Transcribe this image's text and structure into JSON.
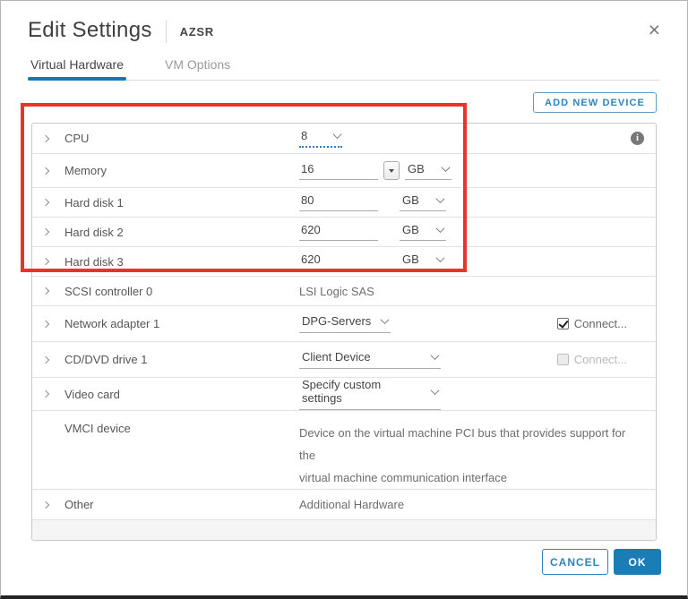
{
  "window": {
    "title": "Edit Settings",
    "vm_name": "AZSR",
    "close_icon": "×"
  },
  "tabs": [
    {
      "label": "Virtual Hardware",
      "active": true
    },
    {
      "label": "VM Options",
      "active": false
    }
  ],
  "toolbar": {
    "add_new_device": "ADD NEW DEVICE"
  },
  "hardware_rows": {
    "cpu": {
      "label": "CPU",
      "value": "8"
    },
    "memory": {
      "label": "Memory",
      "value": "16",
      "unit": "GB"
    },
    "hard_disk_1": {
      "label": "Hard disk 1",
      "value": "80",
      "unit": "GB"
    },
    "hard_disk_2": {
      "label": "Hard disk 2",
      "value": "620",
      "unit": "GB"
    },
    "hard_disk_3": {
      "label": "Hard disk 3",
      "value": "620",
      "unit": "GB"
    },
    "scsi_controller_0": {
      "label": "SCSI controller 0",
      "value": "LSI Logic SAS"
    },
    "network_adapter_1": {
      "label": "Network adapter 1",
      "value": "DPG-Servers",
      "connect_label": "Connect...",
      "connected": true
    },
    "cd_dvd_drive_1": {
      "label": "CD/DVD drive 1",
      "value": "Client Device",
      "connect_label": "Connect...",
      "connected": false
    },
    "video_card": {
      "label": "Video card",
      "value": "Specify custom settings"
    },
    "vmci_device": {
      "label": "VMCI device",
      "description_line_1": "Device on the virtual machine PCI bus that provides support for the",
      "description_line_2": "virtual machine communication interface"
    },
    "other": {
      "label": "Other",
      "value": "Additional Hardware"
    }
  },
  "footer": {
    "cancel": "CANCEL",
    "ok": "OK"
  },
  "colors": {
    "accent_blue": "#1b7db6",
    "annotation_red": "#e8352c",
    "tab_underline": "#0c7bb8"
  }
}
